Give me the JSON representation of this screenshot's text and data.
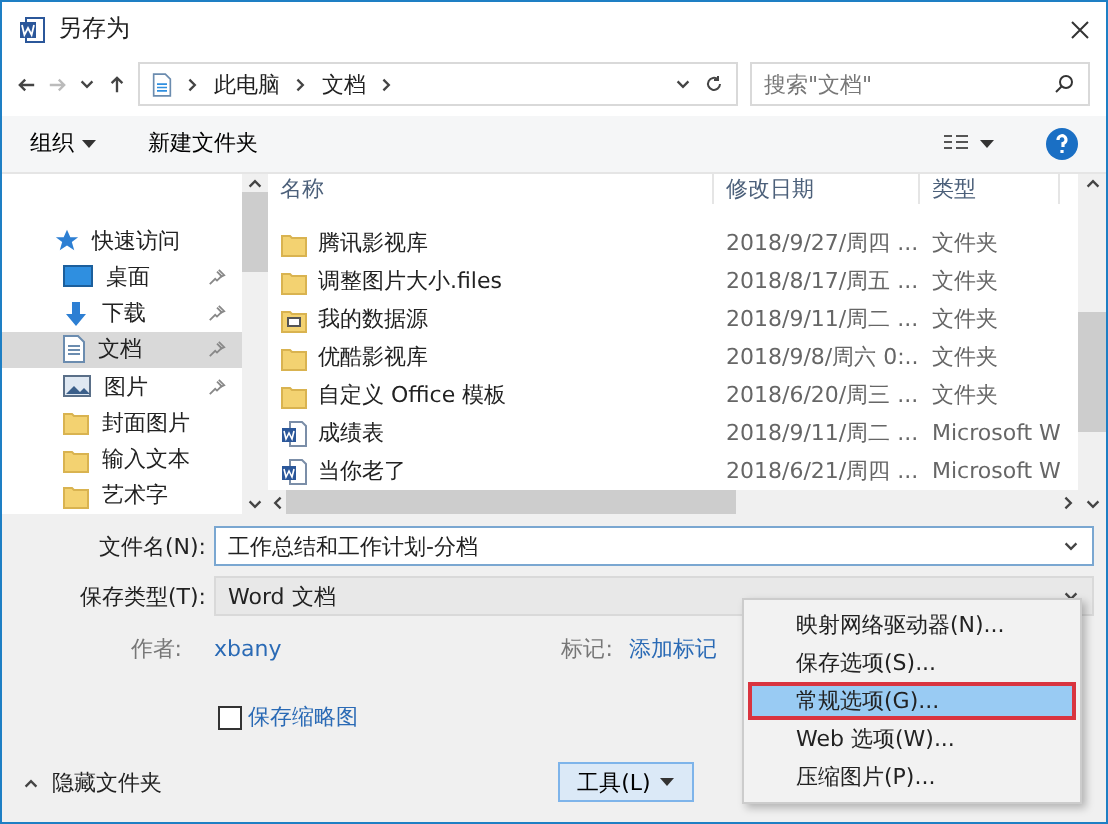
{
  "window": {
    "title": "另存为"
  },
  "address": {
    "crumbs": [
      "此电脑",
      "文档"
    ]
  },
  "search": {
    "placeholder": "搜索\"文档\""
  },
  "toolbar": {
    "organize": "组织",
    "new_folder": "新建文件夹"
  },
  "nav": [
    {
      "label": "快速访问",
      "kind": "star",
      "pinned": false,
      "selected": false
    },
    {
      "label": "桌面",
      "kind": "desktop",
      "pinned": true,
      "selected": false
    },
    {
      "label": "下载",
      "kind": "download",
      "pinned": true,
      "selected": false
    },
    {
      "label": "文档",
      "kind": "document",
      "pinned": true,
      "selected": true
    },
    {
      "label": "图片",
      "kind": "image",
      "pinned": true,
      "selected": false
    },
    {
      "label": "封面图片",
      "kind": "folder",
      "pinned": false,
      "selected": false
    },
    {
      "label": "输入文本",
      "kind": "folder",
      "pinned": false,
      "selected": false
    },
    {
      "label": "艺术字",
      "kind": "folder",
      "pinned": false,
      "selected": false
    }
  ],
  "columns": [
    "名称",
    "修改日期",
    "类型"
  ],
  "files": [
    {
      "name": "腾讯影视库",
      "date": "2018/9/27/周四 ...",
      "type": "文件夹",
      "kind": "folder"
    },
    {
      "name": "调整图片大小.files",
      "date": "2018/8/17/周五 ...",
      "type": "文件夹",
      "kind": "folder"
    },
    {
      "name": "我的数据源",
      "date": "2018/9/11/周二 ...",
      "type": "文件夹",
      "kind": "datasource"
    },
    {
      "name": "优酷影视库",
      "date": "2018/9/8/周六 0:...",
      "type": "文件夹",
      "kind": "folder"
    },
    {
      "name": "自定义 Office 模板",
      "date": "2018/6/20/周三 ...",
      "type": "文件夹",
      "kind": "folder"
    },
    {
      "name": "成绩表",
      "date": "2018/9/11/周二 ...",
      "type": "Microsoft W",
      "kind": "word"
    },
    {
      "name": "当你老了",
      "date": "2018/6/21/周四 ...",
      "type": "Microsoft W",
      "kind": "word"
    }
  ],
  "form": {
    "filename_label": "文件名(N):",
    "filename": "工作总结和工作计划-分档",
    "type_label": "保存类型(T):",
    "type": "Word 文档",
    "author_label": "作者:",
    "author": "xbany",
    "tags_label": "标记:",
    "tags": "添加标记",
    "thumbnail_label": "保存缩略图",
    "thumbnail_checked": false
  },
  "footer": {
    "hide_folders": "隐藏文件夹",
    "tools": "工具(L)"
  },
  "menu": [
    {
      "label": "映射网络驱动器(N)...",
      "selected": false
    },
    {
      "label": "保存选项(S)...",
      "selected": false
    },
    {
      "label": "常规选项(G)...",
      "selected": true
    },
    {
      "label": "Web 选项(W)...",
      "selected": false
    },
    {
      "label": "压缩图片(P)...",
      "selected": false
    }
  ]
}
